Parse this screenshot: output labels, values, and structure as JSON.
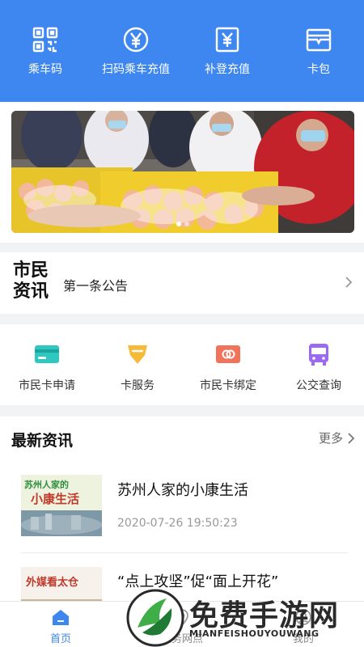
{
  "colors": {
    "primary": "#3f87f0",
    "background": "#f2f3f5"
  },
  "quick_actions": [
    {
      "label": "乘车码",
      "icon": "qr-code-icon"
    },
    {
      "label": "扫码乘车充值",
      "icon": "yen-coin-icon"
    },
    {
      "label": "补登充值",
      "icon": "yen-document-icon"
    },
    {
      "label": "卡包",
      "icon": "card-wallet-icon"
    }
  ],
  "banner": {
    "alt": "banner-photo",
    "slides": 2,
    "active_slide": 1
  },
  "notice": {
    "title": "市民\n资讯",
    "text": "第一条公告"
  },
  "services": [
    {
      "label": "市民卡申请",
      "icon": "citizen-card-icon"
    },
    {
      "label": "卡服务",
      "icon": "card-service-icon"
    },
    {
      "label": "市民卡绑定",
      "icon": "card-bind-icon"
    },
    {
      "label": "公交查询",
      "icon": "bus-icon"
    }
  ],
  "news": {
    "header": "最新资讯",
    "more": "更多",
    "items": [
      {
        "title": "苏州人家的小康生活",
        "time": "2020-07-26 19:50:23",
        "thumb_text_1": "苏州人家的",
        "thumb_text_2": "小康生活"
      },
      {
        "title": "“点上攻坚”促“面上开花”",
        "time": "",
        "thumb_text_1": "外媒看太仓",
        "thumb_text_2": ""
      }
    ]
  },
  "tabbar": [
    {
      "label": "首页",
      "icon": "home-icon",
      "active": true
    },
    {
      "label": "服务网点",
      "icon": "map-pin-icon",
      "active": false
    },
    {
      "label": "我的",
      "icon": "profile-icon",
      "active": false
    }
  ],
  "watermark": {
    "text": "免费手游网",
    "sub": "MIANFEISHOUYOUWANG"
  }
}
